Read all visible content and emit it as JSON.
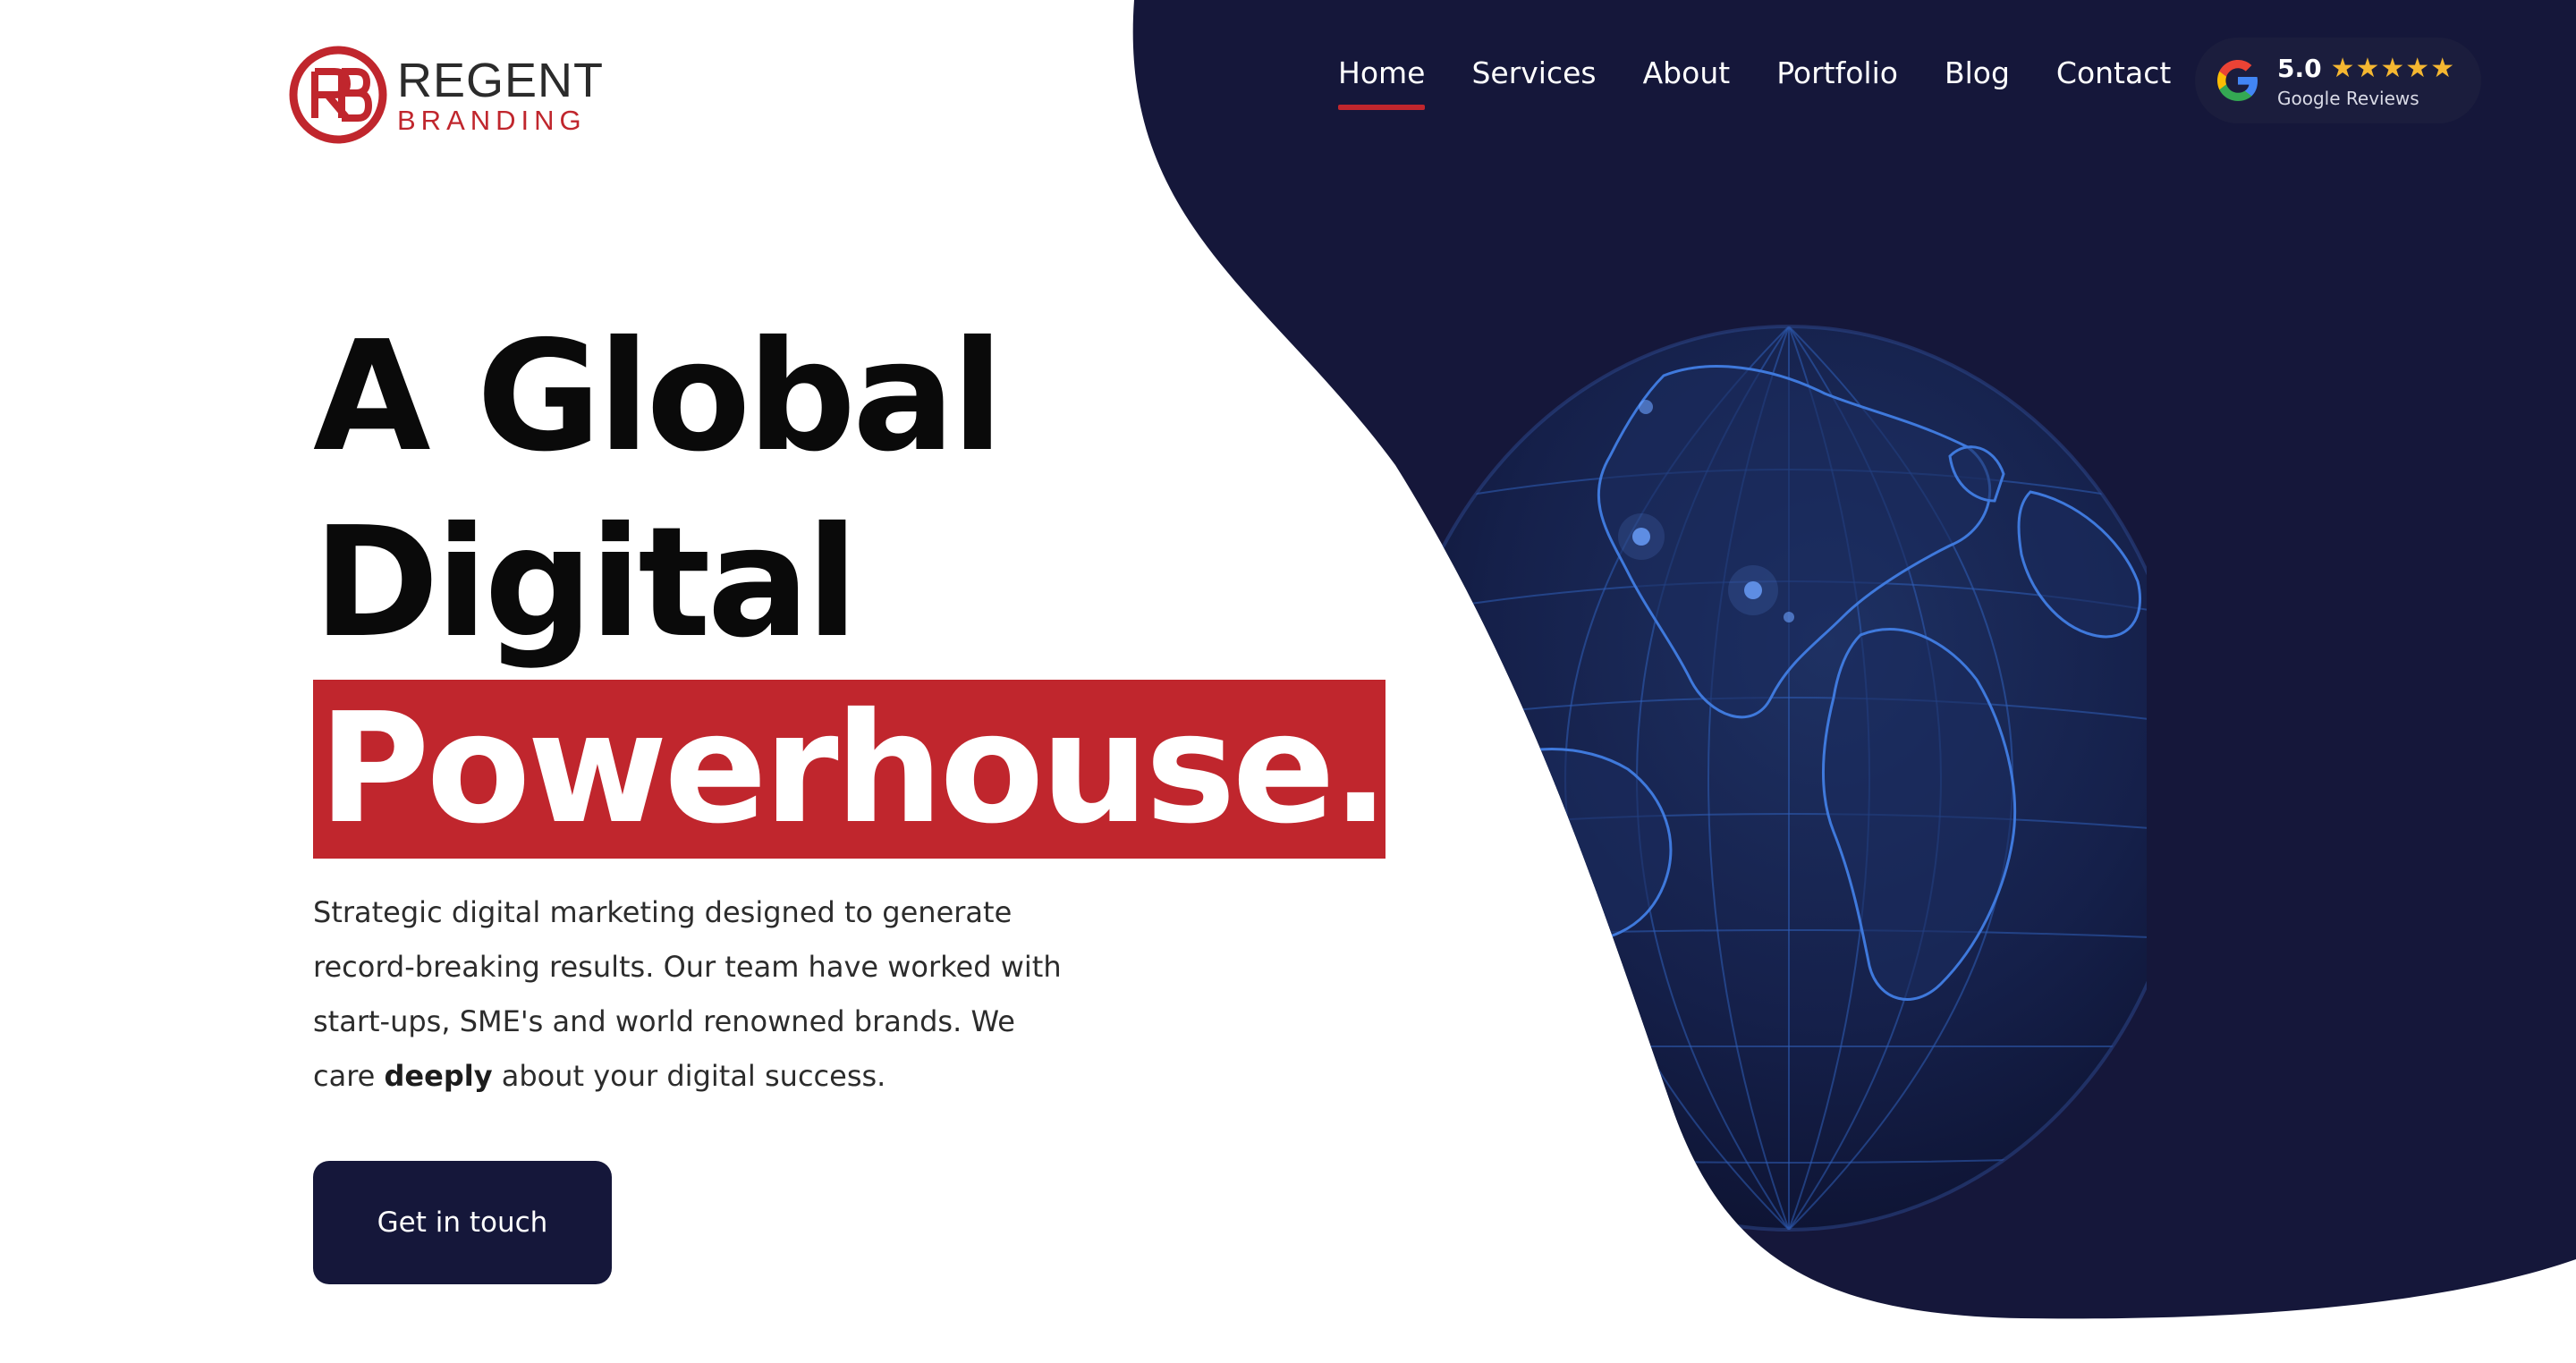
{
  "brand": {
    "name_top": "REGENT",
    "name_bottom": "BRANDING",
    "logo_icon": "rb-monogram-icon",
    "primary_color": "#c0262d",
    "dark_color": "#15173a"
  },
  "nav": {
    "items": [
      {
        "label": "Home",
        "active": true
      },
      {
        "label": "Services",
        "active": false
      },
      {
        "label": "About",
        "active": false
      },
      {
        "label": "Portfolio",
        "active": false
      },
      {
        "label": "Blog",
        "active": false
      },
      {
        "label": "Contact",
        "active": false
      }
    ]
  },
  "reviews": {
    "rating": "5.0",
    "stars": "★★★★★",
    "label": "Google Reviews",
    "icon": "google-g-icon",
    "star_color": "#f5b731"
  },
  "hero": {
    "line1": "A Global",
    "line2": "Digital",
    "line3": "Powerhouse.",
    "intro_before": "Strategic digital marketing designed to generate record-breaking results. Our team have worked with start-ups, SME's and world renowned brands. We care ",
    "intro_bold": "deeply",
    "intro_after": " about your digital success.",
    "cta_label": "Get in touch",
    "graphic": "digital-globe-image"
  }
}
